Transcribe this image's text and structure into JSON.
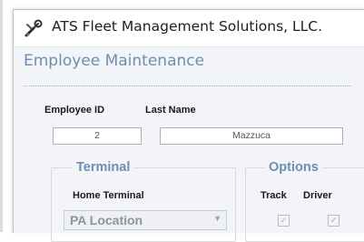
{
  "window": {
    "title": "ATS Fleet Management Solutions, LLC."
  },
  "form": {
    "heading": "Employee Maintenance",
    "employee_id_label": "Employee ID",
    "employee_id_value": "2",
    "last_name_label": "Last Name",
    "last_name_value": "Mazzuca"
  },
  "terminal": {
    "group_label": "Terminal",
    "home_terminal_label": "Home Terminal",
    "home_terminal_value": "PA Location",
    "dropdown_icon": "chevron-down-icon"
  },
  "options": {
    "group_label": "Options",
    "track_label": "Track",
    "driver_label": "Driver",
    "track_checked": true,
    "driver_checked": true
  },
  "icons": {
    "app_icon": "wrench-icon"
  },
  "colors": {
    "heading": "#6e8fb3",
    "background": "#f2f4f8"
  }
}
